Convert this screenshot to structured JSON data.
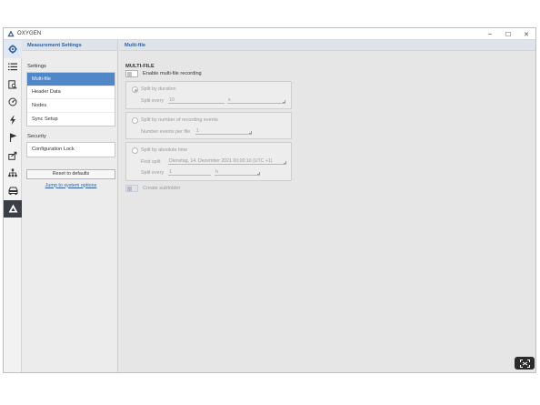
{
  "window": {
    "title": "OXYGEN",
    "controls": {
      "minimize": "−",
      "maximize": "☐",
      "close": "✕"
    }
  },
  "rail": {
    "icons": [
      "gear-icon",
      "list-icon",
      "document-search-icon",
      "speedometer-icon",
      "lightning-icon",
      "flag-icon",
      "export-icon",
      "network-icon",
      "car-icon",
      "brand-triangle-icon"
    ],
    "active": "gear-icon"
  },
  "settings_panel": {
    "title": "Measurement Settings",
    "settings_label": "Settings",
    "settings_items": [
      "Multi-file",
      "Header Data",
      "Nodes",
      "Sync Setup"
    ],
    "selected_item": "Multi-file",
    "security_label": "Security",
    "security_items": [
      "Configuration Lock"
    ],
    "reset_button": "Reset to defaults",
    "system_link": "Jump to system options"
  },
  "main": {
    "title": "Multi-file",
    "section_title": "MULTI-FILE",
    "enable_toggle": {
      "label": "Enable multi-file recording",
      "on": false
    },
    "split_duration": {
      "label": "Split by duration",
      "checked": true,
      "split_every_label": "Split every",
      "split_every_value": "10",
      "unit_value": "s"
    },
    "split_events": {
      "label": "Split by number of recording events",
      "checked": false,
      "events_label": "Number events per file",
      "events_value": "1"
    },
    "split_absolute": {
      "label": "Split by absolute time",
      "checked": false,
      "first_split_label": "First split",
      "first_split_value": "Dienstag, 14. Dezember 2021 00:00:10 (UTC +1)",
      "split_every_label": "Split every",
      "split_every_value": "1",
      "unit_value": "h"
    },
    "subfolder_toggle": {
      "label": "Create subfolder",
      "on": false
    }
  },
  "colors": {
    "accent": "#4f87c9",
    "header_text": "#2f5f9e",
    "brand_dark": "#3a3f45"
  }
}
